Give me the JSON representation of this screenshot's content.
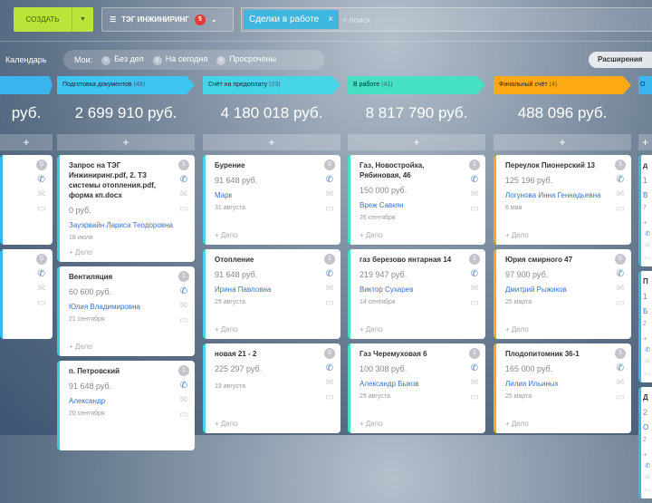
{
  "toolbar": {
    "create_label": "СОЗДАТЬ",
    "filter_label": "ТЭГ ИНЖИНИРИНГ",
    "filter_count": "5",
    "search_tag": "Сделки в работе",
    "search_placeholder": "+ поиск"
  },
  "subbar": {
    "calendar": "Календарь",
    "mine": "Мои:",
    "no_deals": "Без дел",
    "today": "На сегодня",
    "overdue": "Просрочены",
    "no_deals_count": "0",
    "today_count": "0",
    "overdue_count": "0",
    "extensions": "Расширения"
  },
  "columns": [
    {
      "title": "",
      "count": "",
      "sum": "руб.",
      "color": "#3ab5ee",
      "cards": [
        {
          "title": "",
          "price": "",
          "person": "",
          "date": "",
          "badge": "0",
          "deal": ""
        },
        {
          "title": "",
          "price": "",
          "person": "",
          "date": "",
          "badge": "0",
          "deal": ""
        }
      ]
    },
    {
      "title": "Подготовка документов",
      "count": "(48)",
      "sum": "2 699 910 руб.",
      "color": "#3ec6f2",
      "cards": [
        {
          "title": "Запрос на ТЭГ Инжиниринг.pdf, 2. ТЗ системы отопления.pdf, форма кп.docx",
          "price": "0 руб.",
          "person": "Зауэрвайн Лариса Теодоровна",
          "date": "18 июля",
          "badge": "1",
          "deal": "+ Дело"
        },
        {
          "title": "Вентиляция",
          "price": "60 600 руб.",
          "person": "Юлия Владимировна",
          "date": "21 сентября",
          "badge": "1",
          "deal": "+ Дело"
        },
        {
          "title": "п. Петровский",
          "price": "91 648 руб.",
          "person": "Александр",
          "date": "20 сентября",
          "badge": "1",
          "deal": ""
        }
      ]
    },
    {
      "title": "Счёт на предоплату",
      "count": "(23)",
      "sum": "4 180 018 руб.",
      "color": "#45d4e8",
      "cards": [
        {
          "title": "Бурение",
          "price": "91 648 руб.",
          "person": "Марк",
          "date": "31 августа",
          "badge": "0",
          "deal": "+ Дело"
        },
        {
          "title": "Отопление",
          "price": "91 648 руб.",
          "person": "Ирина Павловна",
          "date": "29 августа",
          "badge": "1",
          "deal": "+ Дело"
        },
        {
          "title": "новая 21 - 2",
          "price": "225 297 руб.",
          "person": "",
          "date": "19 августа",
          "badge": "0",
          "deal": "+ Дело"
        }
      ]
    },
    {
      "title": "В работе",
      "count": "(41)",
      "sum": "8 817 790 руб.",
      "color": "#46e0c4",
      "cards": [
        {
          "title": "Газ, Новостройка, Рябиновая, 46",
          "price": "150 000 руб.",
          "person": "Вреж Савкян",
          "date": "26 сентября",
          "badge": "1",
          "deal": "+ Дело"
        },
        {
          "title": "газ березово янтарная 14",
          "price": "219 947 руб.",
          "person": "Виктор Сухарев",
          "date": "14 сентября",
          "badge": "1",
          "deal": "+ Дело"
        },
        {
          "title": "Газ Черемуховая 6",
          "price": "100 308 руб.",
          "person": "Александр Быков",
          "date": "29 августа",
          "badge": "1",
          "deal": "+ Дело"
        }
      ]
    },
    {
      "title": "Финальный счёт",
      "count": "(4)",
      "sum": "488 096 руб.",
      "color": "#ffa914",
      "cards": [
        {
          "title": "Переулок Пионерский 13",
          "price": "125 196 руб.",
          "person": "Логунова Инна Геннадьевна",
          "date": "6 мая",
          "badge": "1",
          "deal": "+ Дело"
        },
        {
          "title": "Юрия смирного 47",
          "price": "97 900 руб.",
          "person": "Дмитрий Рыжиков",
          "date": "25 марта",
          "badge": "0",
          "deal": "+ Дело"
        },
        {
          "title": "Плодопитомник 36-1",
          "price": "165 000 руб.",
          "person": "Лилия Ильиных",
          "date": "25 марта",
          "badge": "1",
          "deal": "+ Дело"
        }
      ]
    },
    {
      "title": "О",
      "count": "",
      "sum": "",
      "color": "#3ab5ee",
      "cards": [
        {
          "title": "д",
          "price": "1",
          "person": "В",
          "date": "7",
          "badge": "",
          "deal": "+"
        },
        {
          "title": "П",
          "price": "1",
          "person": "Б",
          "date": "2",
          "badge": "",
          "deal": "+"
        },
        {
          "title": "Д",
          "price": "2",
          "person": "О",
          "date": "2",
          "badge": "",
          "deal": "+"
        }
      ]
    }
  ]
}
